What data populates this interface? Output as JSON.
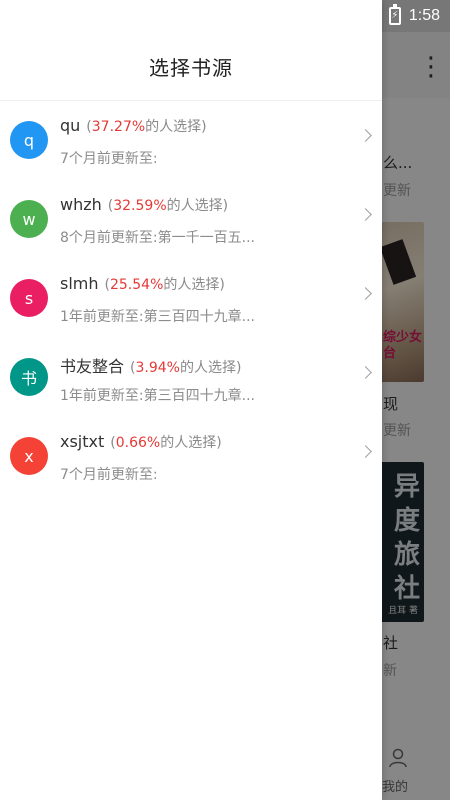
{
  "status_bar": {
    "time": "1:58",
    "battery_icon": "battery-charging-icon"
  },
  "drawer": {
    "title": "选择书源",
    "sources": [
      {
        "avatar_letter": "q",
        "avatar_color": "#2196f3",
        "name": "qu",
        "percent": "37.27%",
        "suffix": "的人选择",
        "update": "7个月前更新至:"
      },
      {
        "avatar_letter": "w",
        "avatar_color": "#4caf50",
        "name": "whzh",
        "percent": "32.59%",
        "suffix": "的人选择",
        "update": "8个月前更新至:第一千一百五..."
      },
      {
        "avatar_letter": "s",
        "avatar_color": "#e91e63",
        "name": "slmh",
        "percent": "25.54%",
        "suffix": "的人选择",
        "update": "1年前更新至:第三百四十九章..."
      },
      {
        "avatar_letter": "书",
        "avatar_color": "#009688",
        "name": "书友整合",
        "percent": "3.94%",
        "suffix": "的人选择",
        "update": "1年前更新至:第三百四十九章..."
      },
      {
        "avatar_letter": "x",
        "avatar_color": "#f44336",
        "name": "xsjtxt",
        "percent": "0.66%",
        "suffix": "的人选择",
        "update": "7个月前更新至:"
      }
    ]
  },
  "background": {
    "menu_icon": "more-vert-icon",
    "snippets": [
      {
        "text": "么...",
        "kind": "title"
      },
      {
        "text": "更新",
        "kind": "sub"
      },
      {
        "text": "现",
        "kind": "title"
      },
      {
        "text": "更新",
        "kind": "sub"
      },
      {
        "text": "社",
        "kind": "title"
      },
      {
        "text": "新",
        "kind": "sub"
      }
    ],
    "cover1_title": "综少女\n台",
    "cover2_title": "异\n度\n旅\n社",
    "cover2_author": "且耳 著",
    "tab_label": "我的"
  }
}
